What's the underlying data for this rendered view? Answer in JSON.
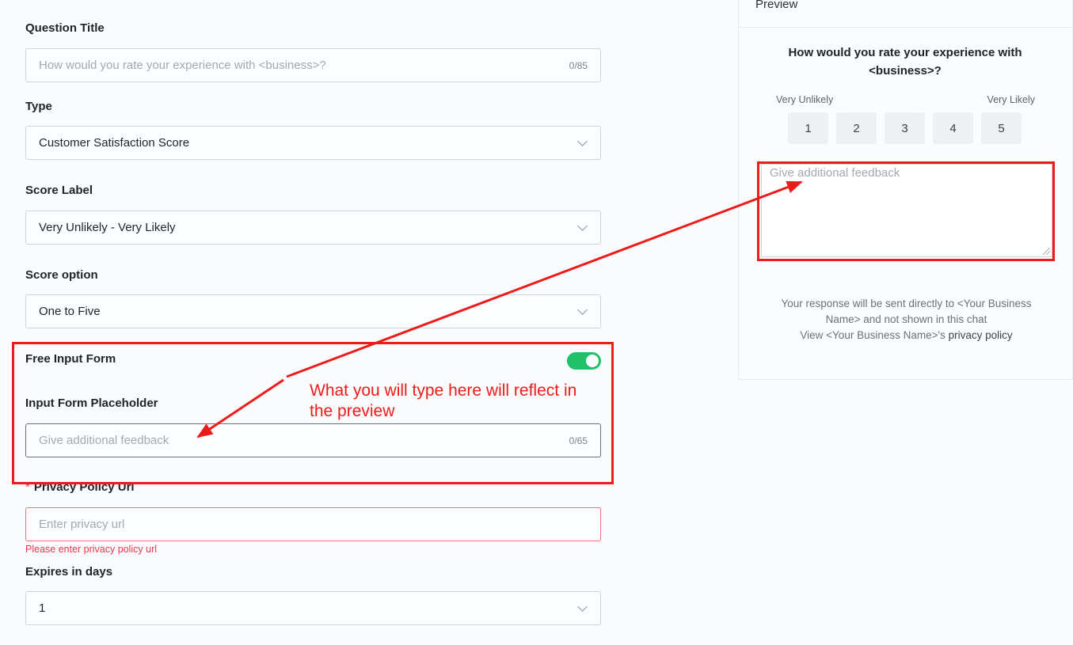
{
  "form": {
    "question_title": {
      "label": "Question Title",
      "placeholder": "How would you rate your experience with <business>?",
      "counter": "0/85"
    },
    "type": {
      "label": "Type",
      "value": "Customer Satisfaction Score"
    },
    "score_label": {
      "label": "Score Label",
      "value": "Very Unlikely - Very Likely"
    },
    "score_option": {
      "label": "Score option",
      "value": "One to Five"
    },
    "free_input_form": {
      "label": "Free Input Form",
      "enabled": true
    },
    "input_form_placeholder": {
      "label": "Input Form Placeholder",
      "placeholder": "Give additional feedback",
      "counter": "0/65"
    },
    "privacy_policy_url": {
      "required_mark": "*",
      "label": "Privacy Policy Url",
      "placeholder": "Enter privacy url",
      "error": "Please enter privacy policy url"
    },
    "expires_in_days": {
      "label": "Expires in days",
      "value": "1"
    }
  },
  "preview": {
    "header": "Preview",
    "question": "How would you rate your experience with <business>?",
    "left_label": "Very Unlikely",
    "right_label": "Very Likely",
    "scores": [
      "1",
      "2",
      "3",
      "4",
      "5"
    ],
    "feedback_placeholder": "Give additional feedback",
    "footer_line1": "Your response will be sent directly to <Your Business Name> and not shown in this chat",
    "footer_line2_prefix": "View <Your Business Name>'s ",
    "footer_link": "privacy policy"
  },
  "annotation": {
    "text": "What you will type here will reflect in the preview",
    "color": "#ee1b1b"
  },
  "colors": {
    "toggle_on": "#21c06b",
    "error": "#e53950"
  }
}
